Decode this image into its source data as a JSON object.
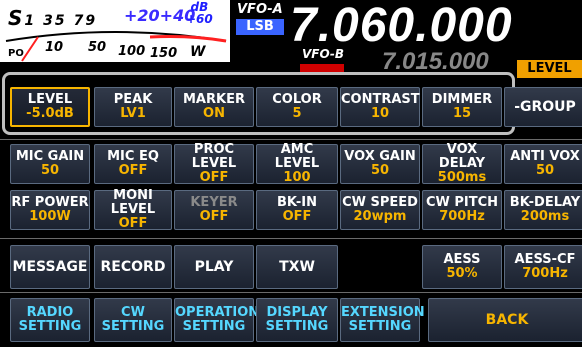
{
  "header": {
    "s_scale": [
      "S",
      "1",
      "3",
      "5",
      "7",
      "9"
    ],
    "plus_scale": "+20+40",
    "db_top": "dB",
    "db_bottom": "+60",
    "meter_bottom": [
      "10",
      "50",
      "100",
      "150"
    ],
    "po": "PO",
    "w": "W",
    "vfo_a_label": "VFO-A",
    "mode": "LSB",
    "freq_a": "7.060.000",
    "vfo_b_label": "VFO-B",
    "freq_b": "7.015.000",
    "level_tag": "LEVEL"
  },
  "rows": [
    [
      {
        "title": "LEVEL",
        "value": "-5.0dB",
        "selected": true
      },
      {
        "title": "PEAK",
        "value": "LV1"
      },
      {
        "title": "MARKER",
        "value": "ON"
      },
      {
        "title": "COLOR",
        "value": "5"
      },
      {
        "title": "CONTRAST",
        "value": "10"
      },
      {
        "title": "DIMMER",
        "value": "15"
      },
      {
        "title": "-GROUP",
        "value": ""
      }
    ],
    [
      {
        "title": "MIC GAIN",
        "value": "50"
      },
      {
        "title": "MIC EQ",
        "value": "OFF"
      },
      {
        "title": "PROC LEVEL",
        "value": "OFF"
      },
      {
        "title": "AMC LEVEL",
        "value": "100"
      },
      {
        "title": "VOX GAIN",
        "value": "50"
      },
      {
        "title": "VOX DELAY",
        "value": "500ms"
      },
      {
        "title": "ANTI VOX",
        "value": "50"
      }
    ],
    [
      {
        "title": "RF POWER",
        "value": "100W"
      },
      {
        "title": "MONI LEVEL",
        "value": "OFF"
      },
      {
        "title": "KEYER",
        "value": "OFF",
        "dim": true
      },
      {
        "title": "BK-IN",
        "value": "OFF"
      },
      {
        "title": "CW SPEED",
        "value": "20wpm"
      },
      {
        "title": "CW PITCH",
        "value": "700Hz"
      },
      {
        "title": "BK-DELAY",
        "value": "200ms"
      }
    ],
    [
      {
        "title": "MESSAGE",
        "value": ""
      },
      {
        "title": "RECORD",
        "value": ""
      },
      {
        "title": "PLAY",
        "value": ""
      },
      {
        "title": "TXW",
        "value": ""
      },
      {
        "title": "",
        "value": "",
        "empty": true
      },
      {
        "title": "AESS",
        "value": "50%"
      },
      {
        "title": "AESS-CF",
        "value": "700Hz"
      }
    ]
  ],
  "bottom": [
    {
      "line1": "RADIO",
      "line2": "SETTING"
    },
    {
      "line1": "CW",
      "line2": "SETTING"
    },
    {
      "line1": "OPERATION",
      "line2": "SETTING"
    },
    {
      "line1": "DISPLAY",
      "line2": "SETTING"
    },
    {
      "line1": "EXTENSION",
      "line2": "SETTING"
    }
  ],
  "back_label": "BACK"
}
